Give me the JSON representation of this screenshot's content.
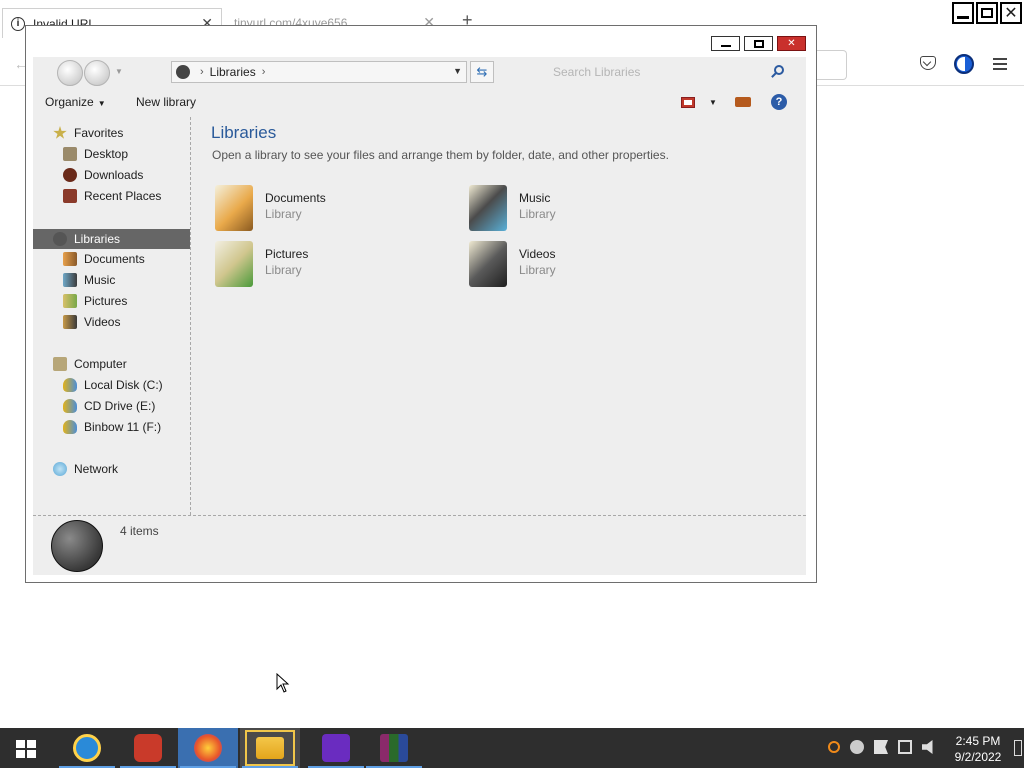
{
  "browser": {
    "tabs": [
      {
        "title": "Invalid URL",
        "active": true
      },
      {
        "title": "tinyurl.com/4xuve656",
        "active": false
      }
    ],
    "new_tab": "+",
    "close_glyph": "✕"
  },
  "explorer": {
    "address": {
      "segments": [
        "Libraries"
      ],
      "separator": "›"
    },
    "search_placeholder": "Search Libraries",
    "commands": {
      "organize": "Organize",
      "new_library": "New library",
      "help": "?"
    },
    "nav": {
      "favorites": {
        "label": "Favorites",
        "items": [
          "Desktop",
          "Downloads",
          "Recent Places"
        ]
      },
      "libraries": {
        "label": "Libraries",
        "items": [
          "Documents",
          "Music",
          "Pictures",
          "Videos"
        ]
      },
      "computer": {
        "label": "Computer",
        "items": [
          "Local Disk (C:)",
          "CD Drive (E:)",
          "Binbow 11 (F:)"
        ]
      },
      "network": {
        "label": "Network"
      }
    },
    "content": {
      "title": "Libraries",
      "subtitle": "Open a library to see your files and arrange them by folder, date, and other properties.",
      "libraries": [
        {
          "name": "Documents",
          "type": "Library",
          "icon": "documents-library-icon"
        },
        {
          "name": "Music",
          "type": "Library",
          "icon": "music-library-icon"
        },
        {
          "name": "Pictures",
          "type": "Library",
          "icon": "pictures-library-icon"
        },
        {
          "name": "Videos",
          "type": "Library",
          "icon": "videos-library-icon"
        }
      ]
    },
    "details": {
      "count_text": "4 items"
    }
  },
  "taskbar": {
    "apps": [
      "internet-explorer",
      "p-app",
      "firefox",
      "file-explorer",
      "yahoo-messenger",
      "winrar"
    ],
    "clock": {
      "time": "2:45 PM",
      "date": "9/2/2022"
    }
  },
  "colors": {
    "title_blue": "#2a5a9a",
    "selected_nav": "#666666",
    "taskbar": "#2e2e2e",
    "close_red": "#c9302c"
  }
}
